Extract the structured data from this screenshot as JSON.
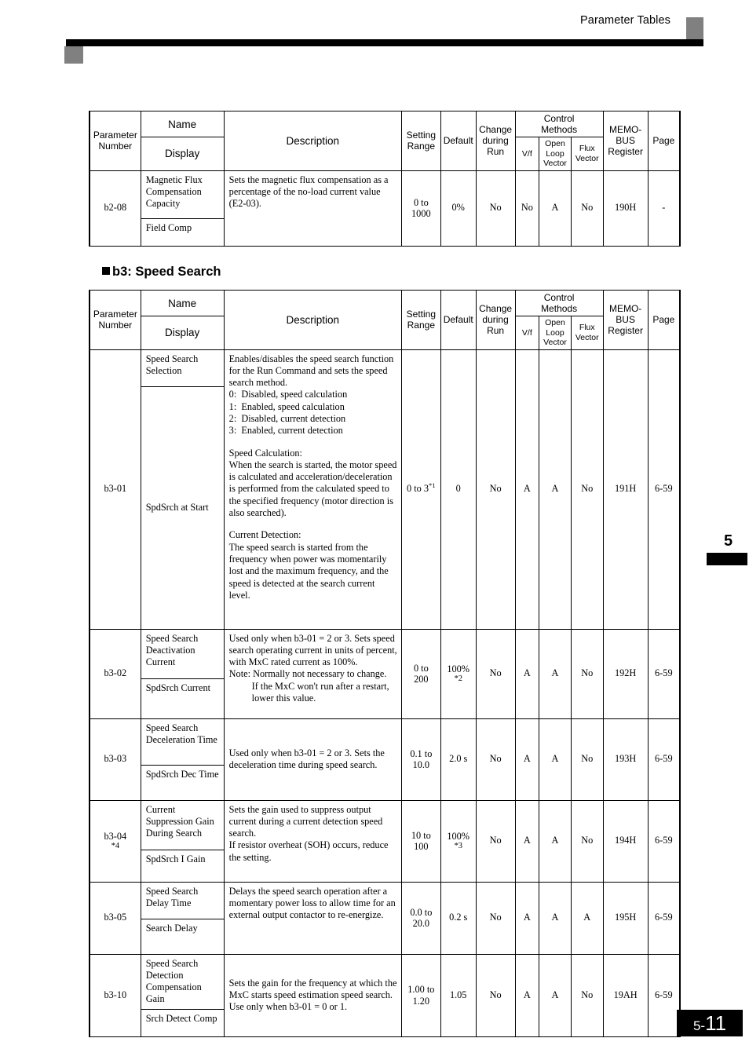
{
  "header": {
    "running_title": "Parameter Tables"
  },
  "thumb_tab": {
    "chapter": "5"
  },
  "folio": {
    "chapter": "5-",
    "page": "11"
  },
  "table_header": {
    "parameter_number": "Parameter\nNumber",
    "name": "Name",
    "display": "Display",
    "description": "Description",
    "setting_range": "Setting\nRange",
    "default": "Default",
    "change_during_run": "Change\nduring\nRun",
    "control_methods": "Control\nMethods",
    "vf": "V/f",
    "open_loop_vector": "Open\nLoop\nVector",
    "flux_vector": "Flux\nVector",
    "memobus_register": "MEMO-\nBUS\nRegister",
    "page": "Page"
  },
  "table_b2": {
    "rows": [
      {
        "parameter_number": "b2-08",
        "name": "Magnetic Flux Compensation Capacity",
        "display": "Field Comp",
        "description": "Sets the magnetic flux compensation as a percentage of the no-load current value (E2-03).",
        "setting_range_line1": "0 to",
        "setting_range_line2": "1000",
        "default": "0%",
        "change_during_run": "No",
        "vf": "No",
        "open_loop_vector": "A",
        "flux_vector": "No",
        "memobus_register": "190H",
        "page": "-"
      }
    ]
  },
  "section_b3": {
    "heading": "b3: Speed Search"
  },
  "table_b3": {
    "rows": [
      {
        "parameter_number": "b3-01",
        "name": "Speed Search Selection",
        "display": "SpdSrch at Start",
        "desc_intro": "Enables/disables the speed search function for the Run Command and sets the speed search method.",
        "desc_options": [
          "0:  Disabled, speed calculation",
          "1:  Enabled, speed calculation",
          "2:  Disabled, current detection",
          "3:  Enabled, current detection"
        ],
        "desc_block2_title": "Speed Calculation:",
        "desc_block2_body": "When the search is started, the motor speed is calculated and acceleration/deceleration is performed from the calculated speed to the specified frequency (motor direction is also searched).",
        "desc_block3_title": "Current Detection:",
        "desc_block3_body": "The speed search is started from the frequency when power was momentarily lost and the maximum frequency, and the speed is detected at the search current level.",
        "setting_range": "0 to 3",
        "setting_range_footnote": "*1",
        "default": "0",
        "change_during_run": "No",
        "vf": "A",
        "open_loop_vector": "A",
        "flux_vector": "No",
        "memobus_register": "191H",
        "page": "6-59"
      },
      {
        "parameter_number": "b3-02",
        "name": "Speed Search Deactivation Current",
        "display": "SpdSrch Current",
        "desc_main": "Used only when b3-01 = 2 or 3. Sets speed search operating current in units of percent, with MxC rated current as 100%.",
        "desc_note": "Note: Normally not necessary to change.",
        "desc_note_cont": "If the MxC won't run after a restart, lower this value.",
        "setting_range_line1": "0 to",
        "setting_range_line2": "200",
        "default": "100%",
        "default_footnote": "*2",
        "change_during_run": "No",
        "vf": "A",
        "open_loop_vector": "A",
        "flux_vector": "No",
        "memobus_register": "192H",
        "page": "6-59"
      },
      {
        "parameter_number": "b3-03",
        "name": "Speed Search Deceleration Time",
        "display": "SpdSrch Dec Time",
        "desc_main": "Used only when b3-01 = 2 or 3. Sets the deceleration time during speed search.",
        "setting_range_line1": "0.1 to",
        "setting_range_line2": "10.0",
        "default": "2.0 s",
        "change_during_run": "No",
        "vf": "A",
        "open_loop_vector": "A",
        "flux_vector": "No",
        "memobus_register": "193H",
        "page": "6-59"
      },
      {
        "parameter_number": "b3-04",
        "parameter_footnote": "*4",
        "name": "Current Suppression Gain During Search",
        "display": "SpdSrch I Gain",
        "desc_main": "Sets the gain used to suppress output current during a current detection speed search.",
        "desc_extra": "If resistor overheat (SOH) occurs, reduce the setting.",
        "setting_range_line1": "10 to",
        "setting_range_line2": "100",
        "default": "100%",
        "default_footnote": "*3",
        "change_during_run": "No",
        "vf": "A",
        "open_loop_vector": "A",
        "flux_vector": "No",
        "memobus_register": "194H",
        "page": "6-59"
      },
      {
        "parameter_number": "b3-05",
        "name": "Speed Search Delay Time",
        "display": "Search Delay",
        "desc_main": "Delays the speed search operation after a momentary power loss to allow time for an external output contactor to re-energize.",
        "setting_range_line1": "0.0 to",
        "setting_range_line2": "20.0",
        "default": "0.2 s",
        "change_during_run": "No",
        "vf": "A",
        "open_loop_vector": "A",
        "flux_vector": "A",
        "memobus_register": "195H",
        "page": "6-59"
      },
      {
        "parameter_number": "b3-10",
        "name": "Speed Search Detection Compensation Gain",
        "display": "Srch Detect Comp",
        "desc_main": "Sets the gain for the frequency at which the MxC starts speed estimation speed search. Use only when b3-01 = 0 or 1.",
        "setting_range_line1": "1.00 to",
        "setting_range_line2": "1.20",
        "default": "1.05",
        "change_during_run": "No",
        "vf": "A",
        "open_loop_vector": "A",
        "flux_vector": "No",
        "memobus_register": "19AH",
        "page": "6-59"
      }
    ]
  }
}
